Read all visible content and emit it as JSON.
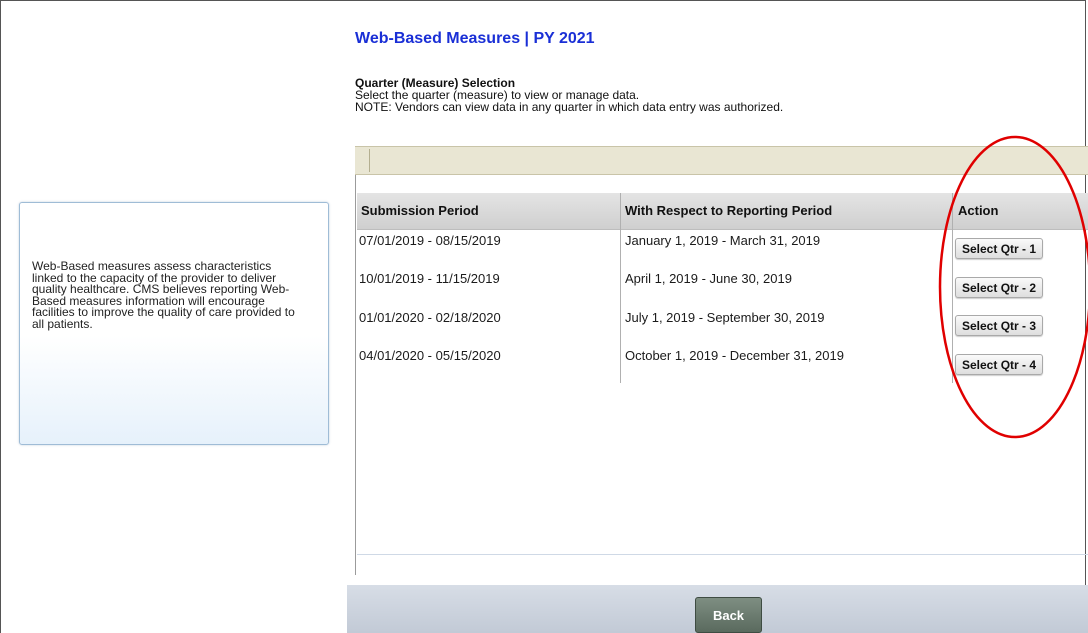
{
  "page": {
    "title": "Web-Based Measures | PY 2021"
  },
  "sidebar": {
    "description": "Web-Based measures assess characteristics linked to the capacity of the provider to deliver quality healthcare. CMS believes reporting Web-Based measures information will encourage facilities to improve the quality of care provided to all patients."
  },
  "selection": {
    "heading": "Quarter (Measure) Selection",
    "instruction": "Select the quarter (measure) to view or manage data.",
    "note": "NOTE: Vendors can view data in any quarter in which data entry was authorized."
  },
  "table": {
    "headers": [
      "Submission Period",
      "With Respect to Reporting Period",
      "Action"
    ],
    "rows": [
      {
        "submission": "07/01/2019 - 08/15/2019",
        "reporting": "January 1, 2019 - March 31, 2019",
        "action": "Select Qtr - 1"
      },
      {
        "submission": "10/01/2019 - 11/15/2019",
        "reporting": "April 1, 2019 - June 30, 2019",
        "action": "Select Qtr - 2"
      },
      {
        "submission": "01/01/2020 - 02/18/2020",
        "reporting": "July 1, 2019 - September 30, 2019",
        "action": "Select Qtr - 3"
      },
      {
        "submission": "04/01/2020 - 05/15/2020",
        "reporting": "October 1, 2019 - December 31, 2019",
        "action": "Select Qtr - 4"
      }
    ]
  },
  "footer": {
    "back_label": "Back"
  },
  "colors": {
    "title_blue": "#1a2fd6",
    "annotation_red": "#e00000",
    "footer_bg": "#c8d0dc",
    "back_button": "#6b7b6f"
  }
}
